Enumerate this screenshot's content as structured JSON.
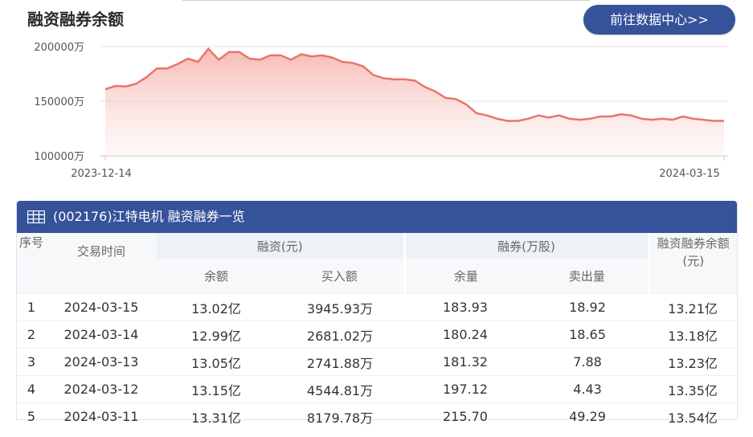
{
  "page_title": "融资融券余额",
  "center_button": "前往数据中心>>",
  "chart_data": {
    "type": "area",
    "y_ticks": [
      "200000万",
      "150000万",
      "100000万"
    ],
    "ylim": [
      100000,
      200000
    ],
    "x_labels": [
      "2023-12-14",
      "2024-03-15"
    ],
    "values": [
      161000,
      164000,
      163500,
      166000,
      172000,
      180000,
      180000,
      184000,
      189000,
      186000,
      198000,
      188000,
      195000,
      195000,
      189000,
      188000,
      192000,
      192000,
      188000,
      193000,
      191000,
      192000,
      190000,
      186000,
      185000,
      182000,
      174000,
      171000,
      170000,
      170000,
      169000,
      163000,
      159000,
      153000,
      152000,
      147000,
      139000,
      137000,
      134000,
      132000,
      132000,
      134000,
      137000,
      135000,
      137000,
      134000,
      133000,
      134000,
      136000,
      136000,
      138000,
      137000,
      134000,
      133000,
      134000,
      133000,
      136000,
      134000,
      133000,
      132000,
      132000
    ],
    "line_color": "#e8756a",
    "grid": true
  },
  "table": {
    "header_title": "(002176)江特电机 融资融券一览",
    "col_seq": "序号",
    "col_date": "交易时间",
    "group_financing": "融资(元)",
    "group_lending": "融券(万股)",
    "col_total": "融资融券余额(元)",
    "sub_balance": "余额",
    "sub_buy": "买入额",
    "sub_remaining": "余量",
    "sub_sell": "卖出量",
    "rows": [
      {
        "seq": "1",
        "date": "2024-03-15",
        "balance": "13.02亿",
        "buy": "3945.93万",
        "remaining": "183.93",
        "sell": "18.92",
        "total": "13.21亿"
      },
      {
        "seq": "2",
        "date": "2024-03-14",
        "balance": "12.99亿",
        "buy": "2681.02万",
        "remaining": "180.24",
        "sell": "18.65",
        "total": "13.18亿"
      },
      {
        "seq": "3",
        "date": "2024-03-13",
        "balance": "13.05亿",
        "buy": "2741.88万",
        "remaining": "181.32",
        "sell": "7.88",
        "total": "13.23亿"
      },
      {
        "seq": "4",
        "date": "2024-03-12",
        "balance": "13.15亿",
        "buy": "4544.81万",
        "remaining": "197.12",
        "sell": "4.43",
        "total": "13.35亿"
      },
      {
        "seq": "5",
        "date": "2024-03-11",
        "balance": "13.31亿",
        "buy": "8179.78万",
        "remaining": "215.70",
        "sell": "49.29",
        "total": "13.54亿"
      }
    ]
  }
}
